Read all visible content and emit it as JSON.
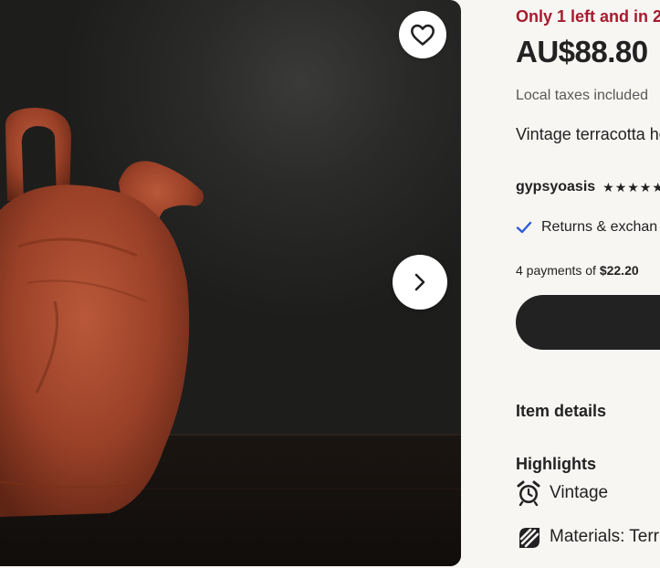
{
  "gallery": {
    "favorite_icon": "heart-icon",
    "next_icon": "chevron-right-icon"
  },
  "listing": {
    "stock_notice": "Only 1 left and in 2",
    "price": "AU$88.80",
    "taxes_note": "Local taxes included",
    "title": "Vintage terracotta home decor",
    "shop_name": "gypsyoasis",
    "stars": "★★★★★",
    "returns": "Returns & exchan",
    "payments_prefix": "4 payments of ",
    "payments_amount": "$22.20"
  },
  "details": {
    "item_details_label": "Item details",
    "highlights_label": "Highlights",
    "highlights": [
      {
        "icon": "alarm-clock-icon",
        "text": "Vintage"
      },
      {
        "icon": "materials-icon",
        "text": "Materials: Terr"
      }
    ]
  },
  "colors": {
    "stock_red": "#a61a2e",
    "check_blue": "#2b5cd6",
    "button_dark": "#222222",
    "page_bg": "#f8f6f3"
  }
}
